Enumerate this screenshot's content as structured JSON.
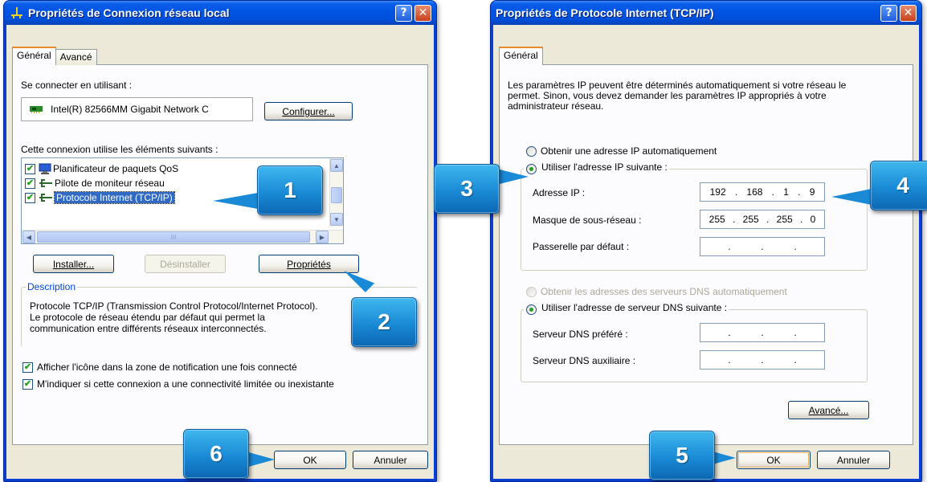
{
  "colors": {
    "titlebar": "#0054e3",
    "callout": "#1a8ad6",
    "client": "#ece9d8",
    "focus_accent": "#e68b2c",
    "check": "#21a121"
  },
  "win_local": {
    "title": "Propriétés de Connexion réseau local",
    "tabs": [
      "Général",
      "Avancé"
    ],
    "connect_using_label": "Se connecter en utilisant :",
    "adapter_name": "Intel(R) 82566MM Gigabit Network C",
    "configure_label": "Configurer...",
    "components_label": "Cette connexion utilise les éléments suivants :",
    "components": [
      {
        "label": "Planificateur de paquets QoS",
        "icon": "qos-scheduler-icon",
        "checked": true
      },
      {
        "label": "Pilote de moniteur réseau",
        "icon": "network-monitor-icon",
        "checked": true
      },
      {
        "label": "Protocole Internet (TCP/IP)",
        "icon": "tcpip-protocol-icon",
        "checked": true,
        "selected": true
      }
    ],
    "scroll_thumb_glyph": "III",
    "install_label": "Installer...",
    "uninstall_label": "Désinstaller",
    "properties_label": "Propriétés",
    "description_title": "Description",
    "description_text": "Protocole TCP/IP (Transmission Control Protocol/Internet Protocol). Le protocole de réseau étendu par défaut qui permet la communication entre différents réseaux interconnectés.",
    "notify_label": "Afficher l'icône dans la zone de notification une fois connecté",
    "notify_checked": true,
    "limited_label": "M'indiquer si cette connexion a une connectivité limitée ou inexistante",
    "limited_checked": true,
    "ok_label": "OK",
    "cancel_label": "Annuler"
  },
  "win_tcpip": {
    "title": "Propriétés de Protocole Internet (TCP/IP)",
    "tabs": [
      "Général"
    ],
    "intro": "Les paramètres IP peuvent être déterminés automatiquement si votre réseau le permet. Sinon, vous devez demander les paramètres IP appropriés à votre administrateur réseau.",
    "auto_ip_label": "Obtenir une adresse IP automatiquement",
    "manual_ip_label": "Utiliser l'adresse IP suivante :",
    "ip_mode": "manual",
    "ip_label": "Adresse IP :",
    "ip_value": [
      "192",
      "168",
      "1",
      "9"
    ],
    "mask_label": "Masque de sous-réseau :",
    "mask_value": [
      "255",
      "255",
      "255",
      "0"
    ],
    "gateway_label": "Passerelle par défaut :",
    "gateway_value": [
      "",
      "",
      "",
      ""
    ],
    "auto_dns_label": "Obtenir les adresses des serveurs DNS automatiquement",
    "manual_dns_label": "Utiliser l'adresse de serveur DNS suivante :",
    "dns_mode": "manual",
    "dns1_label": "Serveur DNS préféré :",
    "dns1_value": [
      "",
      "",
      "",
      ""
    ],
    "dns2_label": "Serveur DNS auxiliaire :",
    "dns2_value": [
      "",
      "",
      "",
      ""
    ],
    "advanced_label": "Avancé...",
    "ok_label": "OK",
    "cancel_label": "Annuler"
  },
  "callouts": [
    "1",
    "2",
    "3",
    "4",
    "5",
    "6"
  ]
}
